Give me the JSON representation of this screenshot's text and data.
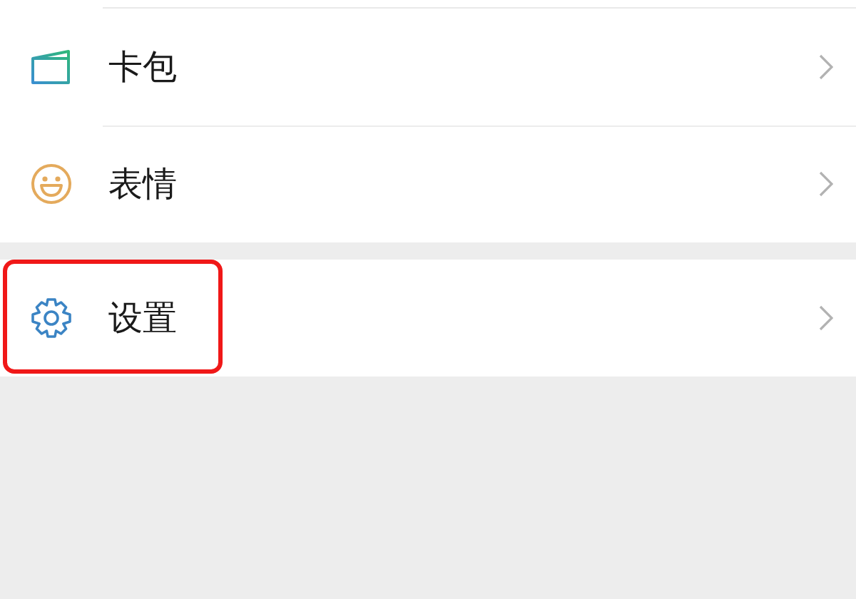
{
  "groups": [
    {
      "items": [
        {
          "label": "卡包",
          "highlighted": false
        },
        {
          "label": "表情",
          "highlighted": false
        }
      ]
    },
    {
      "items": [
        {
          "label": "设置",
          "highlighted": true
        }
      ]
    }
  ]
}
